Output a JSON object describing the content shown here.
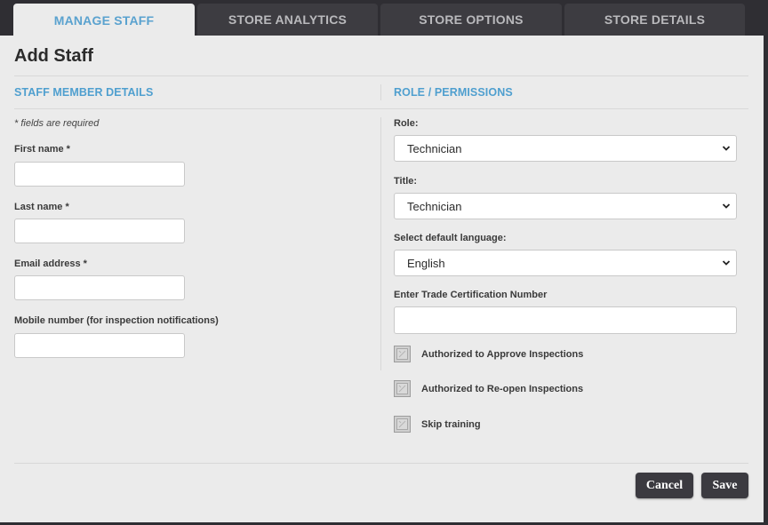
{
  "tabs": [
    {
      "label": "MANAGE STAFF",
      "active": true
    },
    {
      "label": "STORE ANALYTICS",
      "active": false
    },
    {
      "label": "STORE OPTIONS",
      "active": false
    },
    {
      "label": "STORE DETAILS",
      "active": false
    }
  ],
  "page_title": "Add Staff",
  "staff_section": {
    "title": "STAFF MEMBER DETAILS",
    "required_note": "* fields are required",
    "first_name": {
      "label": "First name *",
      "value": ""
    },
    "last_name": {
      "label": "Last name *",
      "value": ""
    },
    "email": {
      "label": "Email address *",
      "value": ""
    },
    "mobile": {
      "label": "Mobile number (for inspection notifications)",
      "value": ""
    }
  },
  "roles_section": {
    "title": "ROLE / PERMISSIONS",
    "role": {
      "label": "Role:",
      "value": "Technician"
    },
    "title_field": {
      "label": "Title:",
      "value": "Technician"
    },
    "language": {
      "label": "Select default language:",
      "value": "English"
    },
    "trade_cert": {
      "label": "Enter Trade Certification Number",
      "value": ""
    },
    "checkboxes": [
      {
        "label": "Authorized to Approve Inspections",
        "checked": false
      },
      {
        "label": "Authorized to Re-open Inspections",
        "checked": false
      },
      {
        "label": "Skip training",
        "checked": false
      }
    ]
  },
  "buttons": {
    "cancel": "Cancel",
    "save": "Save"
  },
  "colors": {
    "accent": "#5aa2cf",
    "dark": "#2f2e33",
    "panel": "#ebebeb"
  },
  "icons": {
    "select_arrow": "chevron-down-icon",
    "checkbox": "checkbox-empty-icon"
  }
}
